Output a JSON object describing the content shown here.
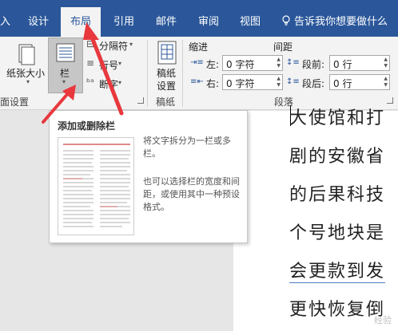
{
  "tabs": [
    {
      "label": "入",
      "active": false
    },
    {
      "label": "设计",
      "active": false
    },
    {
      "label": "布局",
      "active": true
    },
    {
      "label": "引用",
      "active": false
    },
    {
      "label": "邮件",
      "active": false
    },
    {
      "label": "审阅",
      "active": false
    },
    {
      "label": "视图",
      "active": false
    }
  ],
  "tell_me": "告诉我你想要做什么",
  "ribbon": {
    "paper_size": "纸张大小",
    "columns": "栏",
    "breaks": "分隔符",
    "line_numbers": "行号",
    "hyphenation": "断字",
    "page_setup_group": "面设置",
    "draft_paper": [
      "稿纸",
      "设置"
    ],
    "draft_group": "稿纸",
    "indent_label": "缩进",
    "indent_left_label": "左:",
    "indent_left_value": "0 字符",
    "indent_right_label": "右:",
    "indent_right_value": "0 字符",
    "spacing_label": "间距",
    "space_before_label": "段前:",
    "space_before_value": "0 行",
    "space_after_label": "段后:",
    "space_after_value": "0 行",
    "paragraph_group": "段落"
  },
  "tooltip": {
    "title": "添加或删除栏",
    "desc1": "将文字拆分为一栏或多栏。",
    "desc2": "也可以选择栏的宽度和间距，或使用其中一种预设格式。"
  },
  "document_lines": [
    "大使馆和打",
    "剧的安徽省",
    "的后果科技",
    "个号地块是",
    "会更款到发",
    "更快恢复倒"
  ],
  "watermark": "经验",
  "colors": {
    "tab_bar": "#2b579a",
    "ribbon": "#f3f3f3",
    "arrow": "#e8383d"
  }
}
